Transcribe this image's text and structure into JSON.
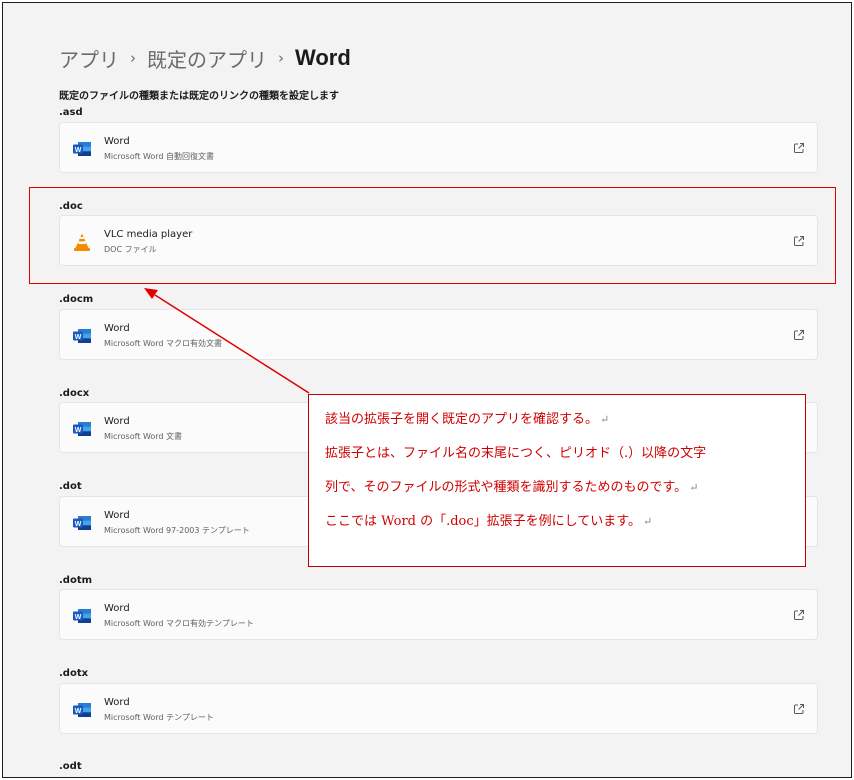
{
  "breadcrumb": [
    "アプリ",
    "既定のアプリ",
    "Word"
  ],
  "breadcrumb_separator": "›",
  "subtitle": "既定のファイルの種類または既定のリンクの種類を設定します",
  "entries": [
    {
      "ext": ".asd",
      "app": "Word",
      "desc": "Microsoft Word 自動回復文書",
      "icon": "word-icon"
    },
    {
      "ext": ".doc",
      "app": "VLC media player",
      "desc": "DOC ファイル",
      "icon": "vlc-icon"
    },
    {
      "ext": ".docm",
      "app": "Word",
      "desc": "Microsoft Word マクロ有効文書",
      "icon": "word-icon"
    },
    {
      "ext": ".docx",
      "app": "Word",
      "desc": "Microsoft Word 文書",
      "icon": "word-icon"
    },
    {
      "ext": ".dot",
      "app": "Word",
      "desc": "Microsoft Word 97-2003 テンプレート",
      "icon": "word-icon"
    },
    {
      "ext": ".dotm",
      "app": "Word",
      "desc": "Microsoft Word マクロ有効テンプレート",
      "icon": "word-icon"
    },
    {
      "ext": ".dotx",
      "app": "Word",
      "desc": "Microsoft Word テンプレート",
      "icon": "word-icon"
    },
    {
      "ext": ".odt"
    }
  ],
  "annotation": {
    "lines": [
      "該当の拡張子を開く既定のアプリを確認する。",
      "拡張子とは、ファイル名の末尾につく、ピリオド（.）以降の文字",
      "列で、そのファイルの形式や種類を識別するためのものです。",
      "ここでは Word の「.doc」拡張子を例にしています。"
    ],
    "return_mark": "↵",
    "color": "#d00000"
  },
  "colors": {
    "accent_red": "#e00000",
    "word_blue": "#185abd",
    "vlc_orange": "#f28c00",
    "background": "#f3f3f3",
    "card": "#fbfbfb"
  }
}
